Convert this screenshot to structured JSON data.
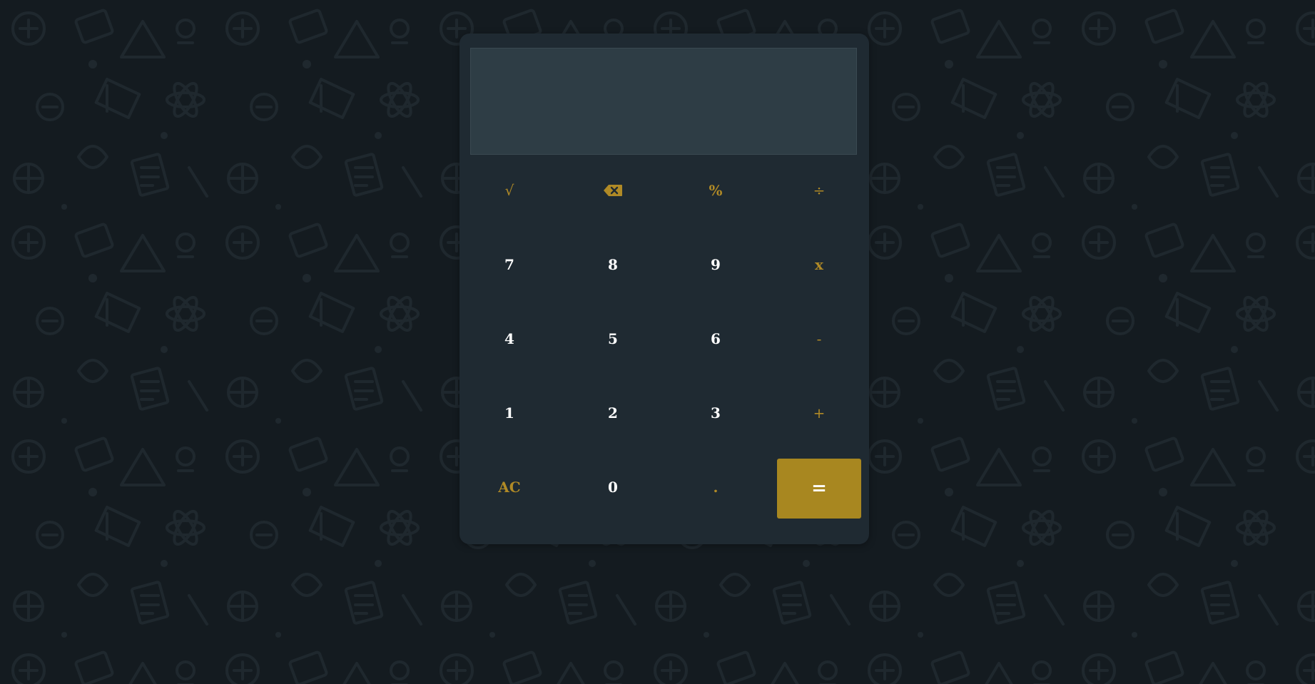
{
  "display": {
    "value": ""
  },
  "keys": {
    "sqrt": "√",
    "backspace_icon": "backspace-icon",
    "percent": "%",
    "divide": "÷",
    "seven": "7",
    "eight": "8",
    "nine": "9",
    "multiply": "x",
    "four": "4",
    "five": "5",
    "six": "6",
    "minus": "-",
    "one": "1",
    "two": "2",
    "three": "3",
    "plus": "+",
    "clear": "AC",
    "zero": "0",
    "decimal": ".",
    "equals": "="
  },
  "colors": {
    "page_background": "#141b20",
    "calculator_body": "#1f2a32",
    "display_background": "#2e3d45",
    "accent": "#b08a26",
    "equals_button": "#a88720",
    "digit_text": "#ffffff"
  },
  "background_pattern": "education-doodle-pattern"
}
